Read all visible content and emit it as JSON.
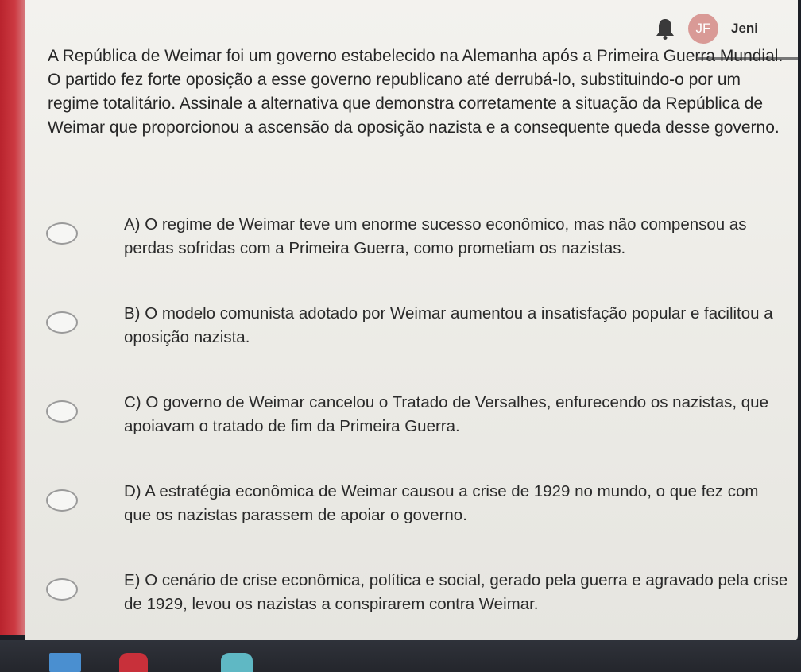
{
  "header": {
    "avatar_initials": "JF",
    "user_name": "Jeni",
    "notification_icon": "bell-icon"
  },
  "question": {
    "text": "A República de Weimar foi um governo estabelecido na Alemanha após a Primeira Guerra Mundial. O partido fez forte oposição a esse governo republicano até derrubá-lo, substituindo-o por um regime totalitário. Assinale a alternativa que demonstra corretamente a situação da República de Weimar que proporcionou a ascensão da oposição nazista e a consequente queda desse governo."
  },
  "options": [
    {
      "text": "A) O regime de Weimar teve um enorme sucesso econômico, mas não compensou as perdas sofridas com a Primeira Guerra, como prometiam os nazistas."
    },
    {
      "text": "B) O modelo comunista adotado por Weimar aumentou a insatisfação popular e facilitou a oposição nazista."
    },
    {
      "text": "C) O governo de Weimar cancelou o Tratado de Versalhes, enfurecendo os nazistas, que apoiavam o tratado de fim da Primeira Guerra."
    },
    {
      "text": "D) A estratégia econômica de Weimar causou a crise de 1929 no mundo, o que fez com que os nazistas parassem de apoiar o governo."
    },
    {
      "text": "E) O cenário de crise econômica, política e social, gerado pela guerra e agravado pela crise de 1929, levou os nazistas a conspirarem contra Weimar."
    }
  ],
  "colors": {
    "accent_red": "#c8303a",
    "avatar": "#d99a96",
    "page_background": "#efeeea"
  }
}
